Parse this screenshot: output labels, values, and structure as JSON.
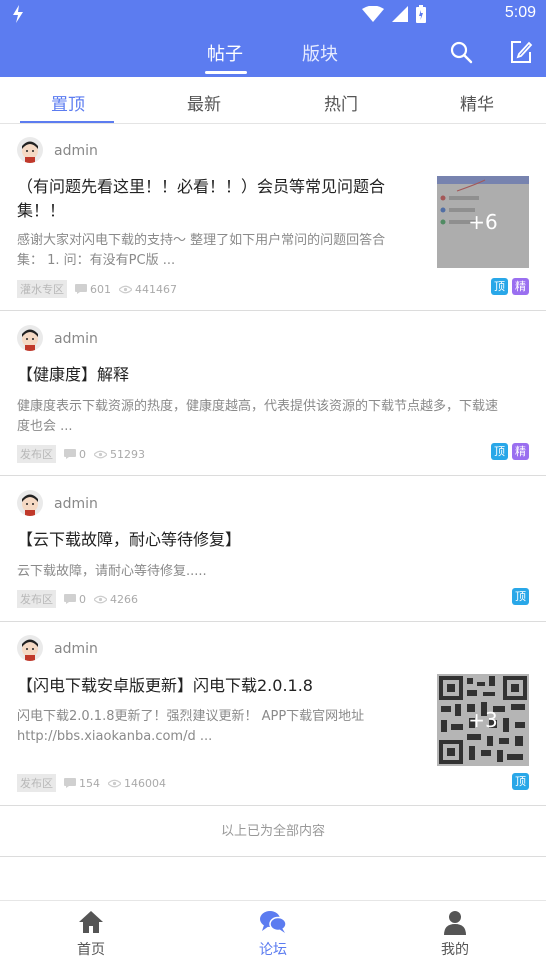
{
  "status_bar": {
    "time": "5:09"
  },
  "header": {
    "tabs": [
      {
        "label": "帖子"
      },
      {
        "label": "版块"
      }
    ]
  },
  "sub_tabs": [
    {
      "label": "置顶"
    },
    {
      "label": "最新"
    },
    {
      "label": "热门"
    },
    {
      "label": "精华"
    }
  ],
  "posts": [
    {
      "author": "admin",
      "title_line1": "（有问题先看这里！！必看！！）会员等常见问题合",
      "title_line2": "集！！",
      "excerpt_line1": "感谢大家对闪电下载的支持～ 整理了如下用户常问的问题回答合",
      "excerpt_line2": "集：  1. 问：有没有PC版 ...",
      "category": "灌水专区",
      "comments": "601",
      "views": "441467",
      "thumb_more": "+6",
      "badges": [
        "顶",
        "精"
      ]
    },
    {
      "author": "admin",
      "title_line1": "【健康度】解释",
      "excerpt_line1": "健康度表示下载资源的热度，健康度越高，代表提供该资源的下载节点越多，下载速",
      "excerpt_line2": "度也会 ...",
      "category": "发布区",
      "comments": "0",
      "views": "51293",
      "badges": [
        "顶",
        "精"
      ]
    },
    {
      "author": "admin",
      "title_line1": "【云下载故障，耐心等待修复】",
      "excerpt_line1": "云下载故障，请耐心等待修复.....",
      "category": "发布区",
      "comments": "0",
      "views": "4266",
      "badges": [
        "顶"
      ]
    },
    {
      "author": "admin",
      "title_line1": "【闪电下载安卓版更新】闪电下载2.0.1.8",
      "excerpt_line1": "闪电下载2.0.1.8更新了！强烈建议更新！ APP下载官网地址",
      "excerpt_line2": "http://bbs.xiaokanba.com/d ...",
      "category": "发布区",
      "comments": "154",
      "views": "146004",
      "thumb_more": "+3",
      "badges": [
        "顶"
      ]
    }
  ],
  "end_note": "以上已为全部内容",
  "bottom_nav": [
    {
      "label": "首页"
    },
    {
      "label": "论坛"
    },
    {
      "label": "我的"
    }
  ],
  "colors": {
    "primary": "#5c7cf0",
    "badge_top": "#29a7e8",
    "badge_essence": "#9a6ff0"
  }
}
